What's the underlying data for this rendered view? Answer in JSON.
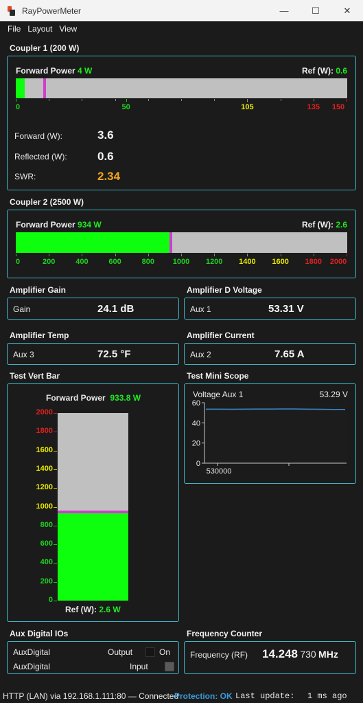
{
  "window": {
    "title": "RayPowerMeter",
    "minimize": "—",
    "maximize": "☐",
    "close": "✕"
  },
  "menu": [
    "File",
    "Layout",
    "View"
  ],
  "coupler1": {
    "title": "Coupler 1 (200 W)",
    "bar_label": "Forward Power",
    "bar_value": "4 W",
    "ref_label": "Ref (W):",
    "ref_value": "0.6",
    "fill_fraction": 0.027,
    "peak_fraction": 0.087,
    "scale_max": 150,
    "ticks": [
      {
        "label": "0",
        "value": 0,
        "color": "green"
      },
      {
        "label": "50",
        "value": 50,
        "color": "green"
      },
      {
        "label": "105",
        "value": 105,
        "color": "yellow"
      },
      {
        "label": "135",
        "value": 135,
        "color": "red"
      },
      {
        "label": "150",
        "value": 150,
        "color": "red"
      }
    ],
    "forward_label": "Forward (W):",
    "forward_value": "3.6",
    "reflected_label": "Reflected (W):",
    "reflected_value": "0.6",
    "swr_label": "SWR:",
    "swr_value": "2.34"
  },
  "coupler2": {
    "title": "Coupler 2 (2500 W)",
    "bar_label": "Forward Power",
    "bar_value": "934 W",
    "ref_label": "Ref (W):",
    "ref_value": "2.6",
    "fill_fraction": 0.467,
    "peak_fraction": 0.467,
    "scale_max": 2000,
    "ticks": [
      {
        "label": "0",
        "value": 0,
        "color": "green"
      },
      {
        "label": "200",
        "value": 200,
        "color": "green"
      },
      {
        "label": "400",
        "value": 400,
        "color": "green"
      },
      {
        "label": "600",
        "value": 600,
        "color": "green"
      },
      {
        "label": "800",
        "value": 800,
        "color": "green"
      },
      {
        "label": "1000",
        "value": 1000,
        "color": "green"
      },
      {
        "label": "1200",
        "value": 1200,
        "color": "green"
      },
      {
        "label": "1400",
        "value": 1400,
        "color": "yellow"
      },
      {
        "label": "1600",
        "value": 1600,
        "color": "yellow"
      },
      {
        "label": "1800",
        "value": 1800,
        "color": "red"
      },
      {
        "label": "2000",
        "value": 2000,
        "color": "red"
      }
    ]
  },
  "amp_gain": {
    "title": "Amplifier Gain",
    "label": "Gain",
    "value": "24.1 dB"
  },
  "amp_dvolt": {
    "title": "Amplifier D Voltage",
    "label": "Aux 1",
    "value": "53.31 V"
  },
  "amp_temp": {
    "title": "Amplifier Temp",
    "label": "Aux 3",
    "value": "72.5 °F"
  },
  "amp_current": {
    "title": "Amplifier Current",
    "label": "Aux 2",
    "value": "7.65 A"
  },
  "vert_bar": {
    "title": "Test Vert Bar",
    "head_label": "Forward Power",
    "head_value": "933.8 W",
    "ref_label": "Ref (W):",
    "ref_value": "2.6 W",
    "fill_fraction": 0.467,
    "scale_max": 2000,
    "scale": [
      {
        "label": "2000",
        "value": 2000,
        "color": "red"
      },
      {
        "label": "1800",
        "value": 1800,
        "color": "red"
      },
      {
        "label": "1600",
        "value": 1600,
        "color": "yellow"
      },
      {
        "label": "1400",
        "value": 1400,
        "color": "yellow"
      },
      {
        "label": "1200",
        "value": 1200,
        "color": "yellow"
      },
      {
        "label": "1000",
        "value": 1000,
        "color": "yellow"
      },
      {
        "label": "800",
        "value": 800,
        "color": "green"
      },
      {
        "label": "600",
        "value": 600,
        "color": "green"
      },
      {
        "label": "400",
        "value": 400,
        "color": "green"
      },
      {
        "label": "200",
        "value": 200,
        "color": "green"
      },
      {
        "label": "0",
        "value": 0,
        "color": "green"
      }
    ]
  },
  "mini_scope": {
    "title": "Test Mini Scope",
    "series_label": "Voltage Aux 1",
    "current_value": "53.29 V",
    "y_ticks": [
      "60",
      "40",
      "20",
      "0"
    ],
    "x_label": "530000"
  },
  "chart_data": {
    "type": "line",
    "series": [
      {
        "name": "Voltage Aux 1",
        "values": [
          53.6,
          53.6,
          53.5,
          53.6,
          53.7,
          53.7,
          53.8,
          53.8,
          53.6,
          53.5,
          53.4,
          53.3
        ]
      }
    ],
    "ylim": [
      0,
      60
    ],
    "y_ticks": [
      0,
      20,
      40,
      60
    ],
    "x_tick_label": "530000"
  },
  "aux_io": {
    "title": "Aux Digital IOs",
    "rows": [
      {
        "label": "AuxDigital",
        "mode": "Output",
        "state": "On"
      },
      {
        "label": "AuxDigital",
        "mode": "Input",
        "state": ""
      }
    ]
  },
  "freq": {
    "title": "Frequency Counter",
    "label": "Frequency (RF)",
    "value_main": "14.248",
    "value_sub": "730",
    "unit": "MHz"
  },
  "status": {
    "connection": "HTTP (LAN) via 192.168.1.111:80 — Connected",
    "protection": "Protection: OK",
    "last_update_label": "Last update:",
    "last_update_value": "1 ms ago"
  },
  "colors": {
    "accent": "#3fb6c6",
    "bar_fill": "#0eff0e",
    "peak": "#d03cd0",
    "track": "#c0c0c0"
  }
}
